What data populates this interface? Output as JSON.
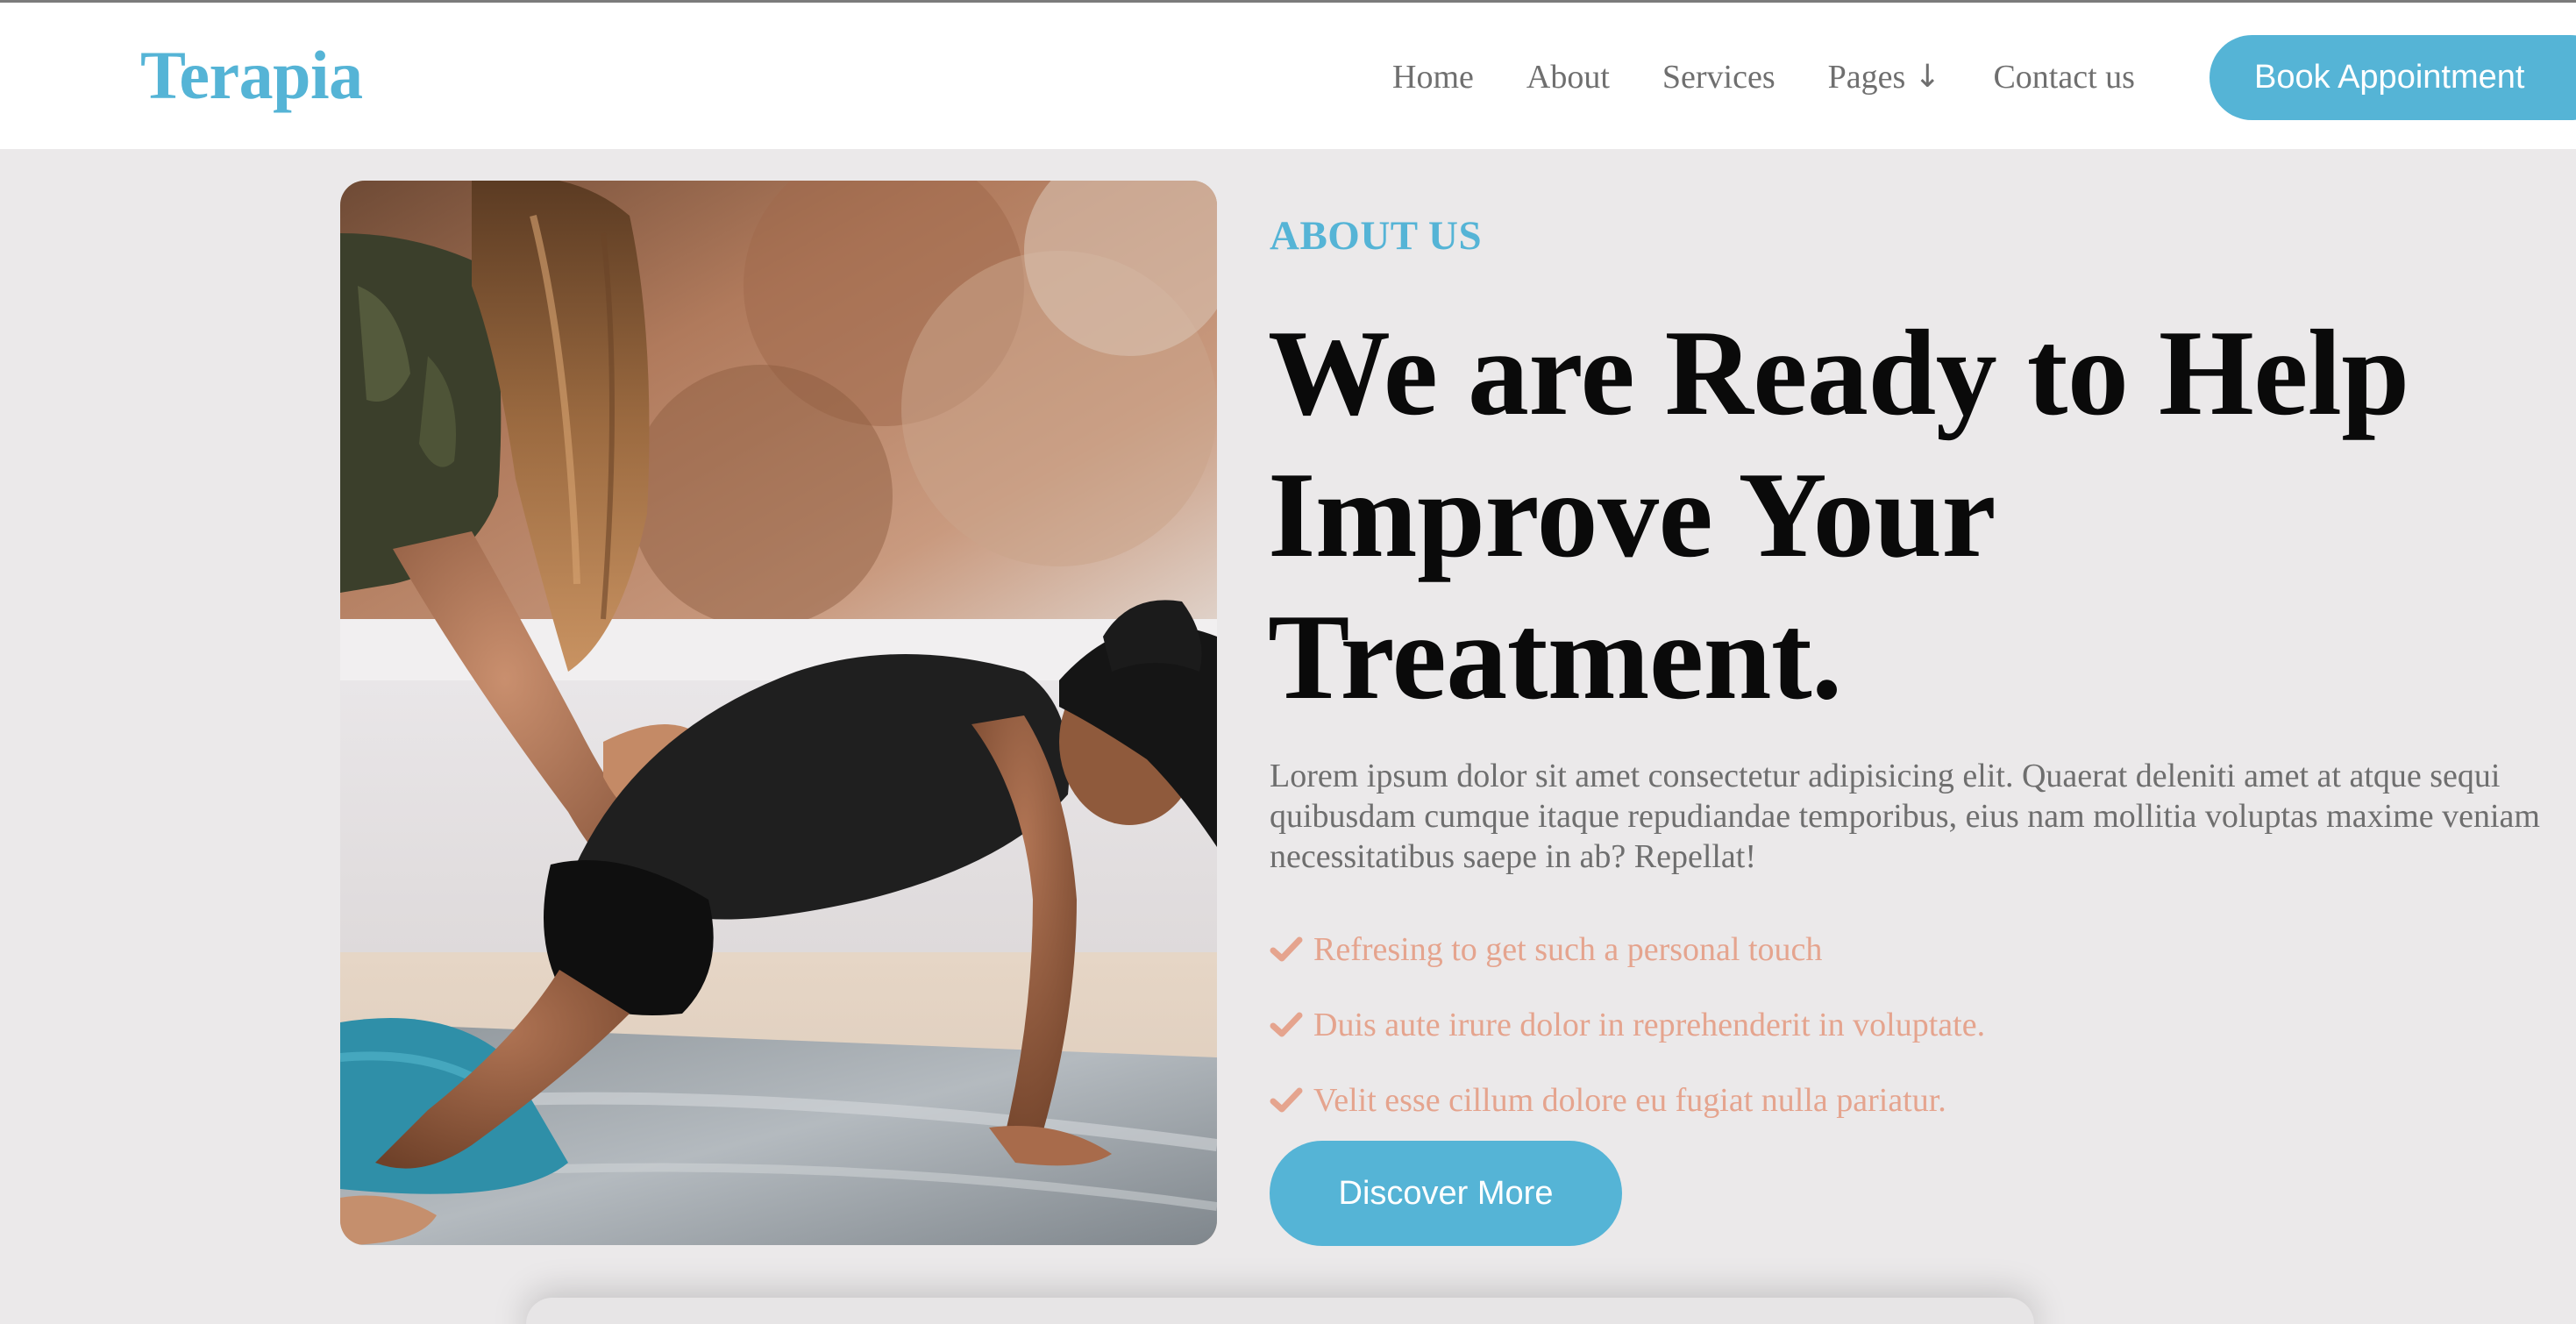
{
  "header": {
    "logo": "Terapia",
    "nav": [
      {
        "label": "Home"
      },
      {
        "label": "About"
      },
      {
        "label": "Services"
      },
      {
        "label": "Pages",
        "icon": "arrow-down-icon"
      },
      {
        "label": "Contact us"
      }
    ],
    "cta_label": "Book Appointment"
  },
  "hero_image": {
    "alt": "Therapist assisting a woman stretching on a mat outdoors"
  },
  "about": {
    "eyebrow": "ABOUT US",
    "headline_lines": [
      "We are Ready to Help",
      "Improve Your",
      "Treatment."
    ],
    "body": "Lorem ipsum dolor sit amet consectetur adipisicing elit. Quaerat deleniti amet at atque sequi quibusdam cumque itaque repudiandae temporibus, eius nam mollitia voluptas maxime veniam necessitatibus saepe in ab? Repellat!",
    "features": [
      "Refresing to get such a personal touch",
      "Duis aute irure dolor in reprehenderit in voluptate.",
      "Velit esse cillum dolore eu fugiat nulla pariatur."
    ],
    "button_label": "Discover More"
  },
  "colors": {
    "accent": "#55b4d6",
    "feature_text": "#e5a48e",
    "page_bg": "#ebe9ea",
    "header_bg": "#ffffff"
  }
}
